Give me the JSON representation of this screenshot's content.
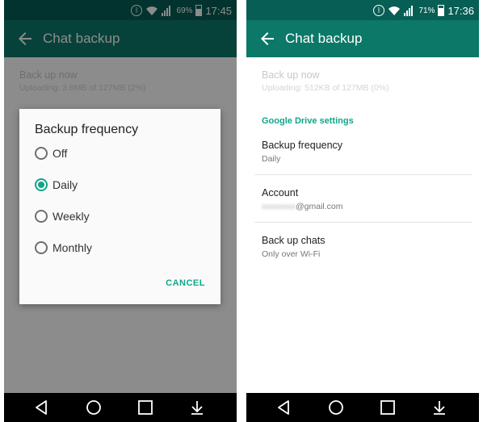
{
  "left": {
    "status": {
      "battery": "69%",
      "battery_level": 0.69,
      "time": "17:45"
    },
    "appbar": {
      "title": "Chat backup"
    },
    "background": {
      "backup_now_title": "Back up now",
      "backup_now_subtitle": "Uploading: 3.6MB of 127MB (2%)"
    },
    "dialog": {
      "title": "Backup frequency",
      "options": [
        {
          "label": "Off",
          "selected": false
        },
        {
          "label": "Daily",
          "selected": true
        },
        {
          "label": "Weekly",
          "selected": false
        },
        {
          "label": "Monthly",
          "selected": false
        }
      ],
      "cancel_label": "CANCEL"
    }
  },
  "right": {
    "status": {
      "battery": "71%",
      "battery_level": 0.71,
      "time": "17:36"
    },
    "appbar": {
      "title": "Chat backup"
    },
    "backup_now": {
      "title": "Back up now",
      "subtitle": "Uploading: 512KB of 127MB (0%)"
    },
    "section_header": "Google Drive settings",
    "prefs": [
      {
        "title": "Backup frequency",
        "subtitle": "Daily"
      },
      {
        "title": "Account",
        "subtitle_blurred": "xxxxxxxx",
        "subtitle": "@gmail.com"
      },
      {
        "title": "Back up chats",
        "subtitle": "Only over Wi-Fi"
      }
    ]
  },
  "icons": {
    "bluetooth": "bluetooth-icon",
    "wifi": "wifi-icon",
    "signal": "signal-icon",
    "battery": "battery-icon",
    "back": "back-arrow-icon",
    "nav_back": "nav-back-icon",
    "nav_home": "nav-home-icon",
    "nav_recents": "nav-recents-icon",
    "nav_down": "nav-notifications-down-icon"
  },
  "colors": {
    "statusbar": "#075e54",
    "appbar": "#0b7868",
    "accent": "#11a58b"
  }
}
